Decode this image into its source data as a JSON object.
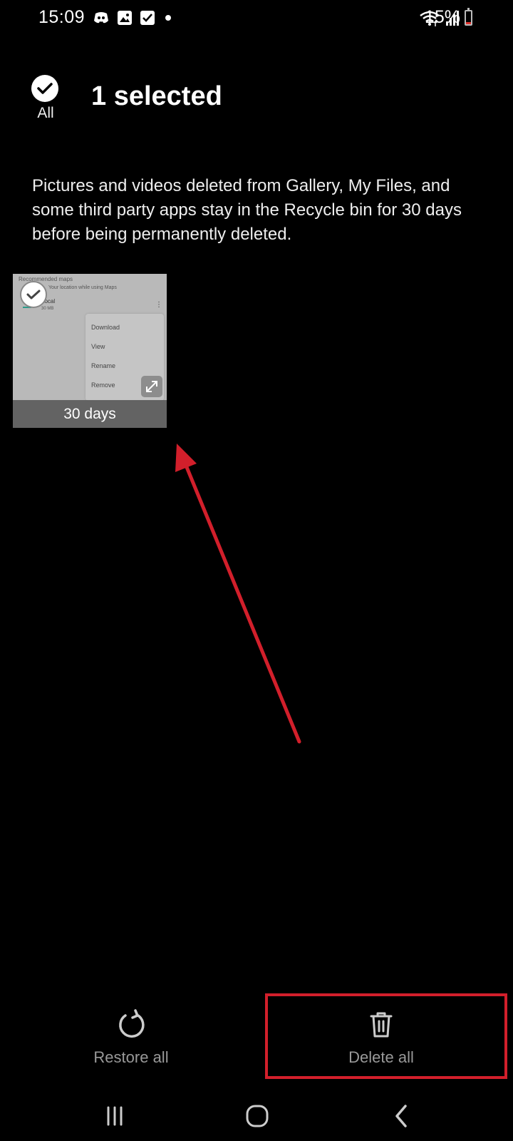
{
  "status_bar": {
    "time": "15:09",
    "battery_percent": "15%",
    "battery_level": 0.15,
    "left_icons": [
      "discord-icon",
      "gallery-icon",
      "checkbox-icon",
      "dot-icon"
    ],
    "right_icons": [
      "wifi-icon",
      "signal-icon"
    ]
  },
  "header": {
    "select_all_label": "All",
    "title": "1 selected"
  },
  "info_text": "Pictures and videos deleted from Gallery, My Files, and some third party apps stay in the Recycle bin for 30 days before being permanently deleted.",
  "items": [
    {
      "caption": "30 days",
      "selected": true,
      "preview": {
        "heading": "Recommended maps",
        "subheading": "Your location while using Maps",
        "row_title": "Local",
        "row_size": "30 MB",
        "menu": [
          "Download",
          "View",
          "Rename",
          "Remove"
        ]
      }
    }
  ],
  "bottom_actions": {
    "restore_label": "Restore all",
    "delete_label": "Delete all"
  },
  "colors": {
    "background": "#000000",
    "annotation_red": "#d21f2b",
    "action_label": "#999999"
  }
}
